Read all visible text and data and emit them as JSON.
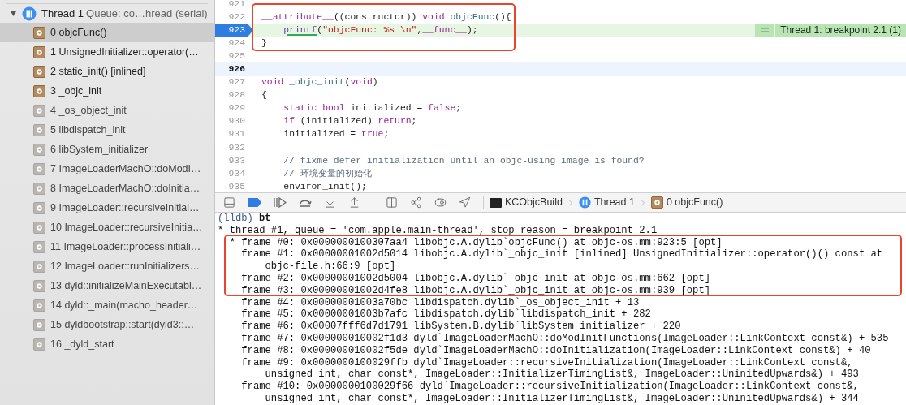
{
  "sidebar": {
    "thread": {
      "name": "Thread 1",
      "queue": "Queue: co…hread (serial)",
      "expanded": true
    },
    "frames": [
      {
        "label": "0 objcFunc()",
        "user_code": true,
        "selected": true
      },
      {
        "label": "1 UnsignedInitializer::operator(…",
        "user_code": true,
        "selected": false
      },
      {
        "label": "2 static_init() [inlined]",
        "user_code": true,
        "selected": false
      },
      {
        "label": "3 _objc_init",
        "user_code": true,
        "selected": false
      },
      {
        "label": "4 _os_object_init",
        "user_code": false,
        "selected": false
      },
      {
        "label": "5 libdispatch_init",
        "user_code": false,
        "selected": false
      },
      {
        "label": "6 libSystem_initializer",
        "user_code": false,
        "selected": false
      },
      {
        "label": "7 ImageLoaderMachO::doModI…",
        "user_code": false,
        "selected": false
      },
      {
        "label": "8 ImageLoaderMachO::doInitia…",
        "user_code": false,
        "selected": false
      },
      {
        "label": "9 ImageLoader::recursiveInitial…",
        "user_code": false,
        "selected": false
      },
      {
        "label": "10 ImageLoader::recursiveInitia…",
        "user_code": false,
        "selected": false
      },
      {
        "label": "11 ImageLoader::processInitiali…",
        "user_code": false,
        "selected": false
      },
      {
        "label": "12 ImageLoader::runInitializers…",
        "user_code": false,
        "selected": false
      },
      {
        "label": "13 dyld::initializeMainExecutabl…",
        "user_code": false,
        "selected": false
      },
      {
        "label": "14 dyld::_main(macho_header…",
        "user_code": false,
        "selected": false
      },
      {
        "label": "15 dyldbootstrap::start(dyld3::…",
        "user_code": false,
        "selected": false
      },
      {
        "label": "16 _dyld_start",
        "user_code": false,
        "selected": false
      }
    ]
  },
  "editor": {
    "lines": [
      {
        "number": "921",
        "current": false,
        "breakpoint": false
      },
      {
        "number": "922",
        "current": false,
        "breakpoint": false,
        "tokens": [
          {
            "text": "__attribute__",
            "kind": "keyword"
          },
          {
            "text": "((constructor))",
            "kind": "plain"
          },
          {
            "text": " void",
            "kind": "keyword"
          },
          {
            "text": " objcFunc",
            "kind": "name"
          },
          {
            "text": "(){",
            "kind": "plain"
          }
        ]
      },
      {
        "number": "923",
        "current": false,
        "breakpoint": true,
        "tokens": [
          {
            "text": "    printf",
            "kind": "call"
          },
          {
            "text": "(",
            "kind": "plain"
          },
          {
            "text": "\"objcFunc: %s \\n\"",
            "kind": "string"
          },
          {
            "text": ",",
            "kind": "plain"
          },
          {
            "text": "__func__",
            "kind": "keyword"
          },
          {
            "text": ");",
            "kind": "plain"
          }
        ]
      },
      {
        "number": "924",
        "current": false,
        "breakpoint": false,
        "tokens": [
          {
            "text": "}",
            "kind": "plain"
          }
        ]
      },
      {
        "number": "925",
        "current": false,
        "breakpoint": false
      },
      {
        "number": "926",
        "current": true,
        "breakpoint": false
      },
      {
        "number": "927",
        "current": false,
        "breakpoint": false,
        "tokens": [
          {
            "text": "void",
            "kind": "keyword"
          },
          {
            "text": " _objc_init",
            "kind": "name"
          },
          {
            "text": "(",
            "kind": "plain"
          },
          {
            "text": "void",
            "kind": "keyword"
          },
          {
            "text": ")",
            "kind": "plain"
          }
        ]
      },
      {
        "number": "928",
        "current": false,
        "breakpoint": false,
        "tokens": [
          {
            "text": "{",
            "kind": "plain"
          }
        ]
      },
      {
        "number": "929",
        "current": false,
        "breakpoint": false,
        "tokens": [
          {
            "text": "    static",
            "kind": "keyword"
          },
          {
            "text": " bool",
            "kind": "keyword"
          },
          {
            "text": " initialized =",
            "kind": "plain"
          },
          {
            "text": " false",
            "kind": "keyword"
          },
          {
            "text": ";",
            "kind": "plain"
          }
        ]
      },
      {
        "number": "930",
        "current": false,
        "breakpoint": false,
        "tokens": [
          {
            "text": "    if",
            "kind": "keyword"
          },
          {
            "text": " (initialized)",
            "kind": "plain"
          },
          {
            "text": " return",
            "kind": "keyword"
          },
          {
            "text": ";",
            "kind": "plain"
          }
        ]
      },
      {
        "number": "931",
        "current": false,
        "breakpoint": false,
        "tokens": [
          {
            "text": "    initialized =",
            "kind": "plain"
          },
          {
            "text": " true",
            "kind": "keyword"
          },
          {
            "text": ";",
            "kind": "plain"
          }
        ]
      },
      {
        "number": "932",
        "current": false,
        "breakpoint": false
      },
      {
        "number": "933",
        "current": false,
        "breakpoint": false,
        "tokens": [
          {
            "text": "    // fixme defer initialization until an objc-using image is found?",
            "kind": "comment"
          }
        ]
      },
      {
        "number": "934",
        "current": false,
        "breakpoint": false,
        "tokens": [
          {
            "text": "    // 环境变量的初始化",
            "kind": "comment"
          }
        ]
      },
      {
        "number": "935",
        "current": false,
        "breakpoint": false,
        "tokens": [
          {
            "text": "    environ_init();",
            "kind": "plain"
          }
        ]
      }
    ],
    "breakpoint_note": "Thread 1: breakpoint 2.1 (1)"
  },
  "debug_bar": {
    "breakpoints_active": true,
    "breadcrumb": [
      {
        "kind": "target",
        "label": "KCObjcBuild"
      },
      {
        "kind": "thread",
        "label": "Thread 1"
      },
      {
        "kind": "frame",
        "label": "0 objcFunc()"
      }
    ]
  },
  "console": {
    "prompt": "(lldb)",
    "command": "bt",
    "lines": [
      "* thread #1, queue = 'com.apple.main-thread', stop reason = breakpoint 2.1",
      "  * frame #0: 0x0000000100307aa4 libobjc.A.dylib`objcFunc() at objc-os.mm:923:5 [opt]",
      "    frame #1: 0x00000001002d5014 libobjc.A.dylib`_objc_init [inlined] UnsignedInitializer::operator()() const at",
      "        objc-file.h:66:9 [opt]",
      "    frame #2: 0x00000001002d5004 libobjc.A.dylib`_objc_init at objc-os.mm:662 [opt]",
      "    frame #3: 0x00000001002d4fe8 libobjc.A.dylib`_objc_init at objc-os.mm:939 [opt]",
      "    frame #4: 0x00000001003a70bc libdispatch.dylib`_os_object_init + 13",
      "    frame #5: 0x00000001003b7afc libdispatch.dylib`libdispatch_init + 282",
      "    frame #6: 0x00007fff6d7d1791 libSystem.B.dylib`libSystem_initializer + 220",
      "    frame #7: 0x000000010002f1d3 dyld`ImageLoaderMachO::doModInitFunctions(ImageLoader::LinkContext const&) + 535",
      "    frame #8: 0x000000010002f5de dyld`ImageLoaderMachO::doInitialization(ImageLoader::LinkContext const&) + 40",
      "    frame #9: 0x0000000100029ffb dyld`ImageLoader::recursiveInitialization(ImageLoader::LinkContext const&,",
      "        unsigned int, char const*, ImageLoader::InitializerTimingList&, ImageLoader::UninitedUpwards&) + 493",
      "    frame #10: 0x0000000100029f66 dyld`ImageLoader::recursiveInitialization(ImageLoader::LinkContext const&,",
      "        unsigned int, char const*, ImageLoader::InitializerTimingList&, ImageLoader::UninitedUpwards&) + 344"
    ]
  }
}
